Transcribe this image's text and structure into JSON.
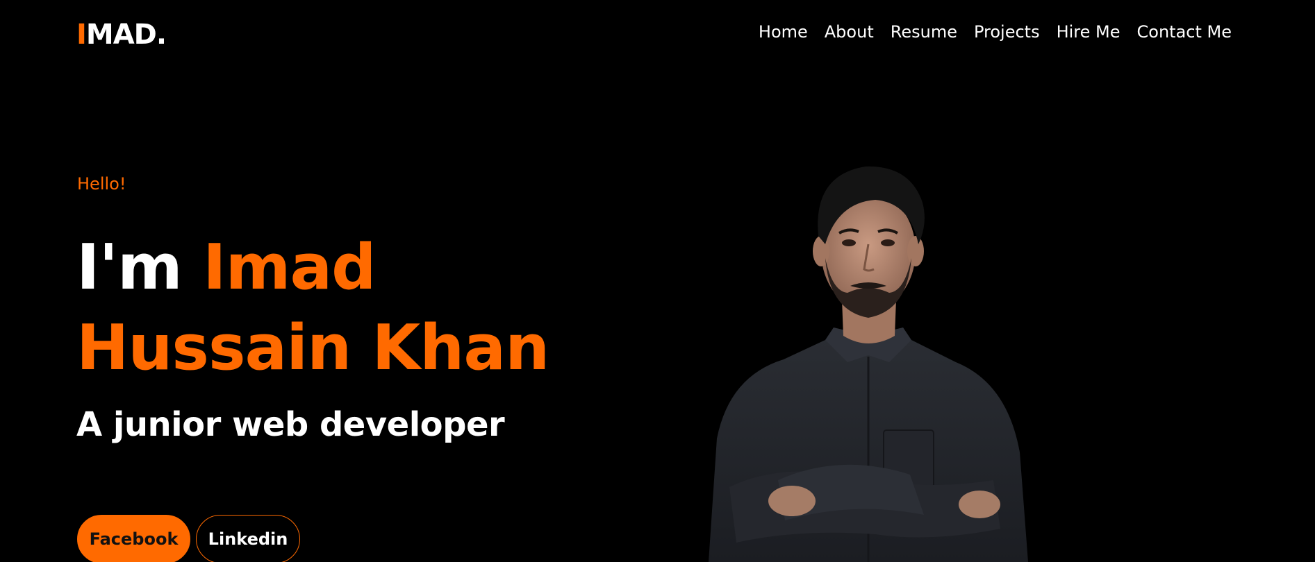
{
  "header": {
    "logo_first": "I",
    "logo_rest": "MAD.",
    "nav": [
      {
        "label": "Home"
      },
      {
        "label": "About"
      },
      {
        "label": "Resume"
      },
      {
        "label": "Projects"
      },
      {
        "label": "Hire Me"
      },
      {
        "label": "Contact Me"
      }
    ]
  },
  "hero": {
    "greeting": "Hello!",
    "title_prefix": "I'm",
    "name_line1": "Imad",
    "name_line2": "Hussain Khan",
    "subtitle": "A junior web developer",
    "buttons": {
      "primary": "Facebook",
      "secondary": "Linkedin"
    }
  },
  "colors": {
    "background": "#000000",
    "accent": "#ff6a00",
    "text": "#ffffff"
  }
}
